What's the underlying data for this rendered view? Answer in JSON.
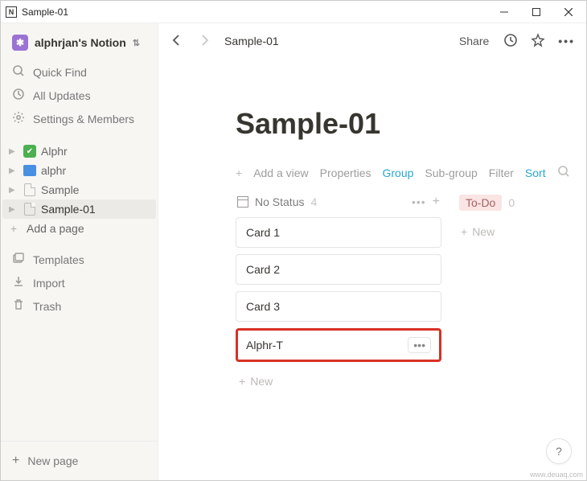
{
  "window": {
    "title": "Sample-01"
  },
  "workspace": {
    "name": "alphrjan's Notion"
  },
  "sidebar": {
    "quick_find": "Quick Find",
    "all_updates": "All Updates",
    "settings": "Settings & Members",
    "tree": [
      {
        "label": "Alphr",
        "icon": "check"
      },
      {
        "label": "alphr",
        "icon": "monitor"
      },
      {
        "label": "Sample",
        "icon": "page"
      },
      {
        "label": "Sample-01",
        "icon": "page",
        "selected": true
      }
    ],
    "add_page": "Add a page",
    "templates": "Templates",
    "import": "Import",
    "trash": "Trash",
    "new_page": "New page"
  },
  "header": {
    "breadcrumb": "Sample-01",
    "share": "Share"
  },
  "page": {
    "title": "Sample-01"
  },
  "toolbar": {
    "add_view": "Add a view",
    "properties": "Properties",
    "group": "Group",
    "subgroup": "Sub-group",
    "filter": "Filter",
    "sort": "Sort"
  },
  "board": {
    "columns": [
      {
        "name": "No Status",
        "count": "4",
        "cards": [
          {
            "title": "Card 1"
          },
          {
            "title": "Card 2"
          },
          {
            "title": "Card 3"
          },
          {
            "title": "Alphr-T",
            "highlighted": true,
            "show_menu": true
          }
        ],
        "new_label": "New"
      },
      {
        "name": "To-Do",
        "count": "0",
        "tag": true,
        "cards": [],
        "new_label": "New"
      }
    ]
  },
  "help": "?",
  "watermark": "www.deuaq.com"
}
